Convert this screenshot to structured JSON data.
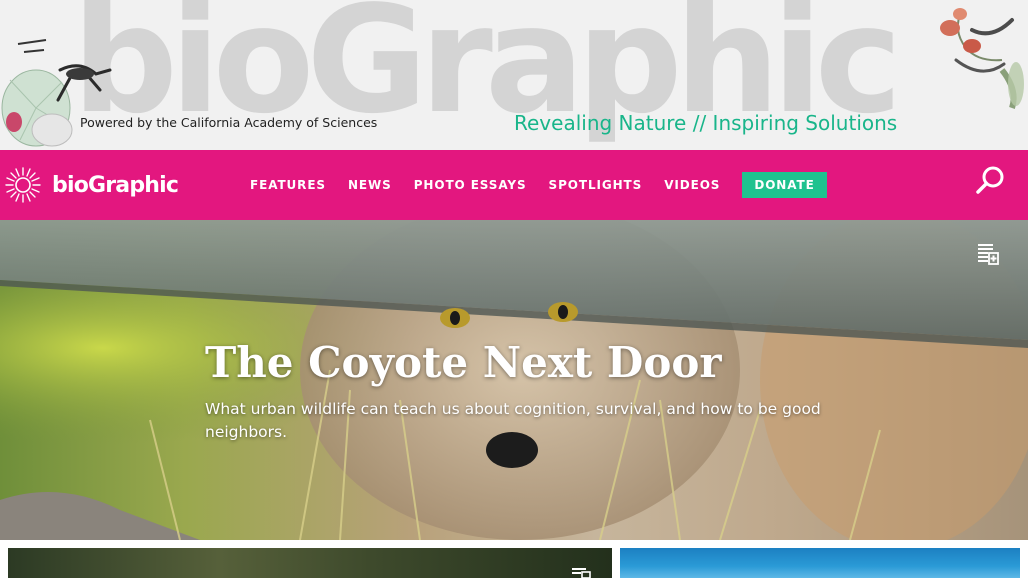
{
  "masthead": {
    "wordmark": "bioGraphic",
    "powered_by": "Powered by the California Academy of Sciences",
    "tagline": "Revealing Nature // Inspiring Solutions"
  },
  "nav": {
    "logo_text": "bioGraphic",
    "links": [
      "FEATURES",
      "NEWS",
      "PHOTO ESSAYS",
      "SPOTLIGHTS",
      "VIDEOS"
    ],
    "donate": "DONATE",
    "search_icon": "search-icon"
  },
  "hero": {
    "title": "The Coyote Next Door",
    "subtitle": "What urban wildlife can teach us about cognition, survival, and how to be good neighbors.",
    "icon": "reading-list-icon"
  },
  "cards": {
    "icon": "reading-list-icon"
  },
  "colors": {
    "brand_pink": "#e3177f",
    "accent_green": "#1fc28f",
    "tagline_green": "#19b58a",
    "masthead_bg": "#f1f1f1"
  }
}
